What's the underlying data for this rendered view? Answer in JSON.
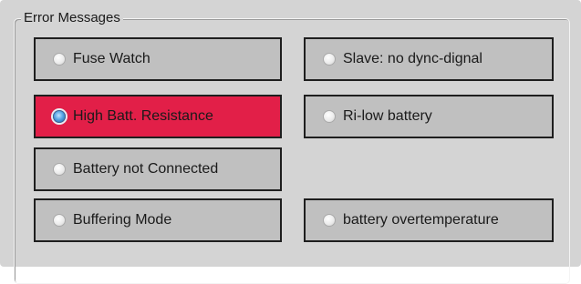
{
  "group": {
    "title": "Error Messages"
  },
  "colors": {
    "panel_bg": "#d4d4d4",
    "button_bg": "#c0c0c0",
    "active_bg": "#e21f48",
    "border": "#1e1e1e"
  },
  "options": {
    "fuse_watch": {
      "label": "Fuse Watch",
      "selected": false
    },
    "slave_no_sync": {
      "label": "Slave: no dync-dignal",
      "selected": false
    },
    "high_batt_resistance": {
      "label": "High Batt. Resistance",
      "selected": true
    },
    "ri_low_battery": {
      "label": "Ri-low battery",
      "selected": false
    },
    "battery_not_connected": {
      "label": "Battery not Connected",
      "selected": false
    },
    "buffering_mode": {
      "label": "Buffering Mode",
      "selected": false
    },
    "battery_overtemperature": {
      "label": "battery overtemperature",
      "selected": false
    }
  }
}
